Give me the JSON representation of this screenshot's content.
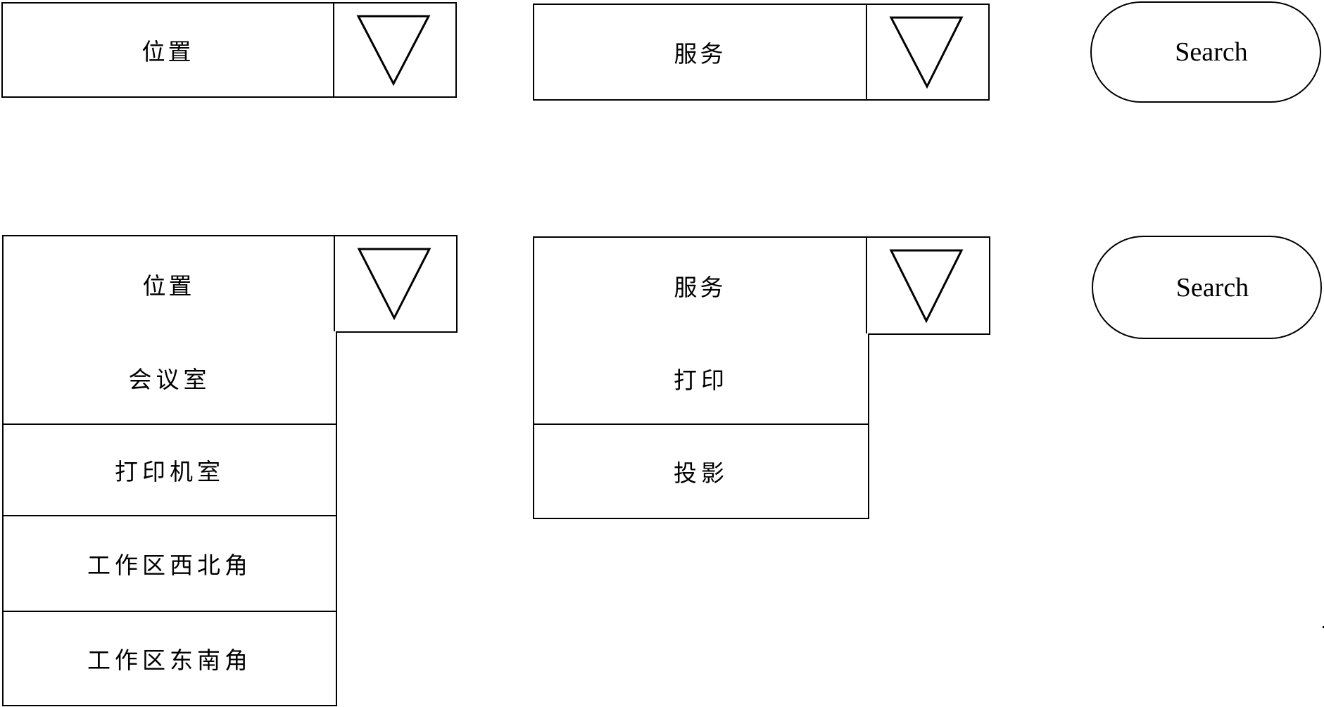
{
  "top_row": {
    "location_select": {
      "label": "位置",
      "toggle_icon": "triangle-down-icon"
    },
    "service_select": {
      "label": "服务",
      "toggle_icon": "triangle-down-icon"
    },
    "search_button": {
      "label": "Search"
    }
  },
  "bottom_row": {
    "location_select": {
      "label": "位置",
      "toggle_icon": "triangle-down-icon",
      "options": [
        {
          "label": "会议室"
        },
        {
          "label": "打印机室"
        },
        {
          "label": "工作区西北角"
        },
        {
          "label": "工作区东南角"
        }
      ]
    },
    "service_select": {
      "label": "服务",
      "toggle_icon": "triangle-down-icon",
      "options": [
        {
          "label": "打印"
        },
        {
          "label": "投影"
        }
      ]
    },
    "search_button": {
      "label": "Search"
    }
  },
  "colors": {
    "line": "#000000",
    "background": "#ffffff"
  }
}
